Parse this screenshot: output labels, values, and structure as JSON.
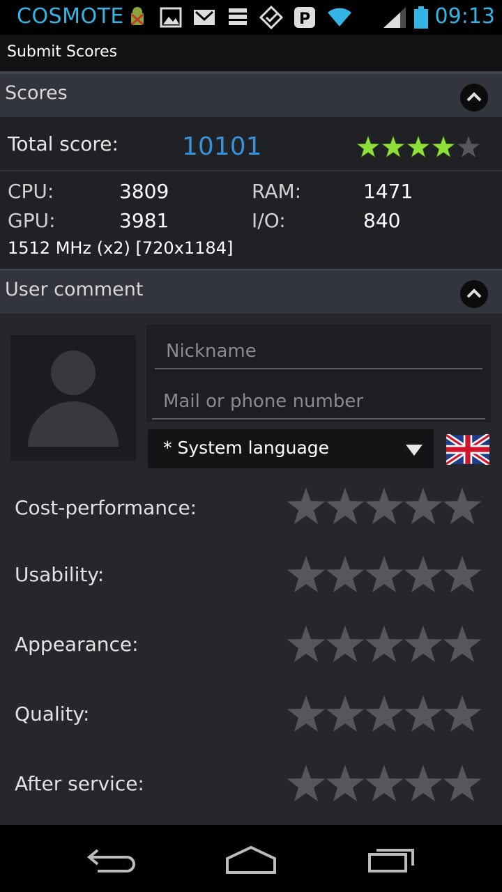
{
  "status_bar": {
    "carrier": "COSMOTE",
    "time": "09:13",
    "accent_color": "#33b5e5",
    "icons": [
      "android-debug-icon",
      "gallery-icon",
      "gmail-icon",
      "task-list-icon",
      "check-shield-icon",
      "pinterest-icon",
      "wifi-icon",
      "signal-icon",
      "battery-icon"
    ]
  },
  "title_bar": {
    "title": "Submit Scores"
  },
  "scores_section": {
    "header": "Scores",
    "total_label": "Total score:",
    "total_value": "10101",
    "total_rating": 4,
    "cpu_label": "CPU:",
    "cpu_value": "3809",
    "ram_label": "RAM:",
    "ram_value": "1471",
    "gpu_label": "GPU:",
    "gpu_value": "3981",
    "io_label": "I/O:",
    "io_value": "840",
    "device_info": "1512 MHz (x2) [720x1184]"
  },
  "comment_section": {
    "header": "User comment",
    "nickname_placeholder": "Nickname",
    "nickname_value": "",
    "contact_placeholder": "Mail or phone number",
    "contact_value": "",
    "language_selected": "* System language",
    "flag": "uk-flag-icon",
    "ratings": [
      {
        "label": "Cost-performance:",
        "value": 0
      },
      {
        "label": "Usability:",
        "value": 0
      },
      {
        "label": "Appearance:",
        "value": 0
      },
      {
        "label": "Quality:",
        "value": 0
      },
      {
        "label": "After service:",
        "value": 0
      }
    ]
  },
  "nav_bar": {
    "buttons": [
      "back-icon",
      "home-icon",
      "recent-apps-icon"
    ]
  },
  "colors": {
    "score_blue": "#3a90d8",
    "star_green": "#8fe03a",
    "star_empty": "#55575b"
  }
}
